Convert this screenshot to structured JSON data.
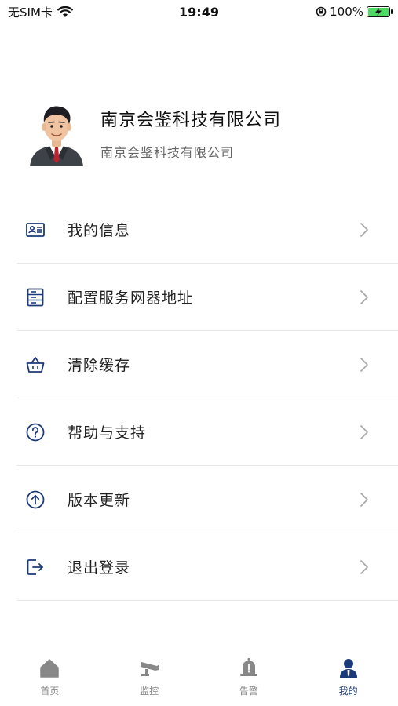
{
  "status_bar": {
    "carrier": "无SIM卡",
    "time": "19:49",
    "battery": "100%"
  },
  "profile": {
    "name": "南京会鉴科技有限公司",
    "subtitle": "南京会鉴科技有限公司"
  },
  "menu": [
    {
      "label": "我的信息",
      "icon": "id-card-icon"
    },
    {
      "label": "配置服务网器地址",
      "icon": "server-icon"
    },
    {
      "label": "清除缓存",
      "icon": "basket-icon"
    },
    {
      "label": "帮助与支持",
      "icon": "help-circle-icon"
    },
    {
      "label": "版本更新",
      "icon": "upload-circle-icon"
    },
    {
      "label": "退出登录",
      "icon": "logout-icon"
    }
  ],
  "tabbar": {
    "tabs": [
      {
        "label": "首页",
        "icon": "home-icon",
        "active": false
      },
      {
        "label": "监控",
        "icon": "camera-icon",
        "active": false
      },
      {
        "label": "告警",
        "icon": "bell-icon",
        "active": false
      },
      {
        "label": "我的",
        "icon": "user-icon",
        "active": true
      }
    ]
  },
  "colors": {
    "accent": "#1c3a7a",
    "inactive": "#888888",
    "divider": "#e6e6e6",
    "battery_fill": "#4cd964"
  }
}
